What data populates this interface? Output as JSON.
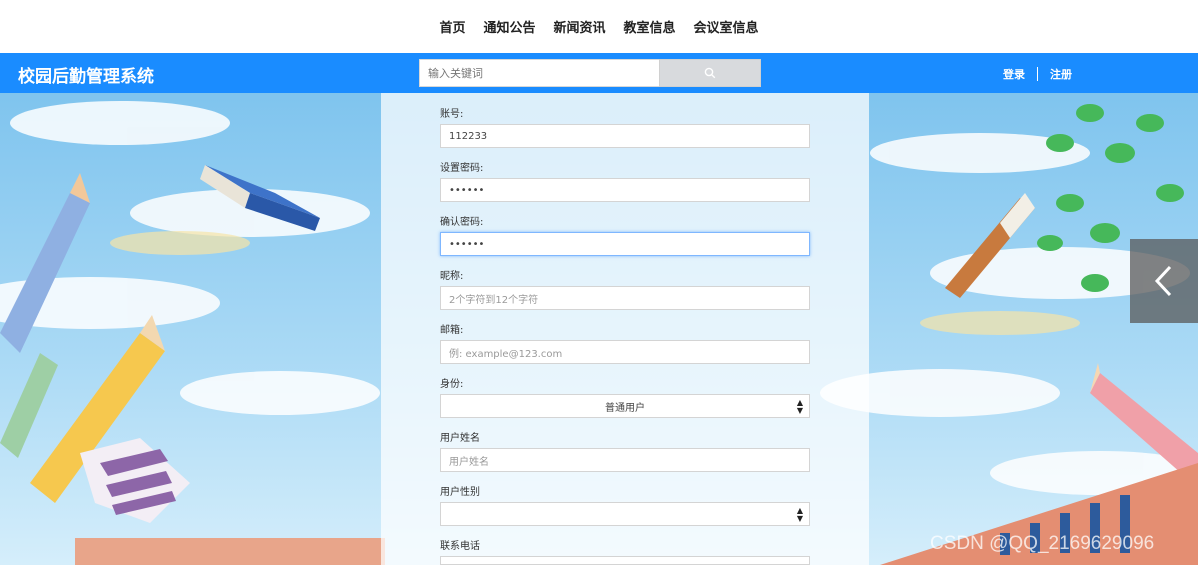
{
  "nav": {
    "items": [
      "首页",
      "通知公告",
      "新闻资讯",
      "教室信息",
      "会议室信息"
    ]
  },
  "header": {
    "brand": "校园后勤管理系统",
    "search_placeholder": "输入关键词",
    "login": "登录",
    "register": "注册",
    "color": "#1a8cff"
  },
  "form": {
    "account": {
      "label": "账号:",
      "value": "112233"
    },
    "password": {
      "label": "设置密码:",
      "value": "••••••"
    },
    "confirm": {
      "label": "确认密码:",
      "value": "••••••"
    },
    "nickname": {
      "label": "昵称:",
      "placeholder": "2个字符到12个字符"
    },
    "email": {
      "label": "邮箱:",
      "placeholder": "例: example@123.com"
    },
    "identity": {
      "label": "身份:",
      "selected": "普通用户"
    },
    "realname": {
      "label": "用户姓名",
      "placeholder": "用户姓名"
    },
    "gender": {
      "label": "用户性别",
      "selected": ""
    },
    "phone": {
      "label": "联系电话"
    }
  },
  "watermark": "CSDN @QQ_2169629096"
}
